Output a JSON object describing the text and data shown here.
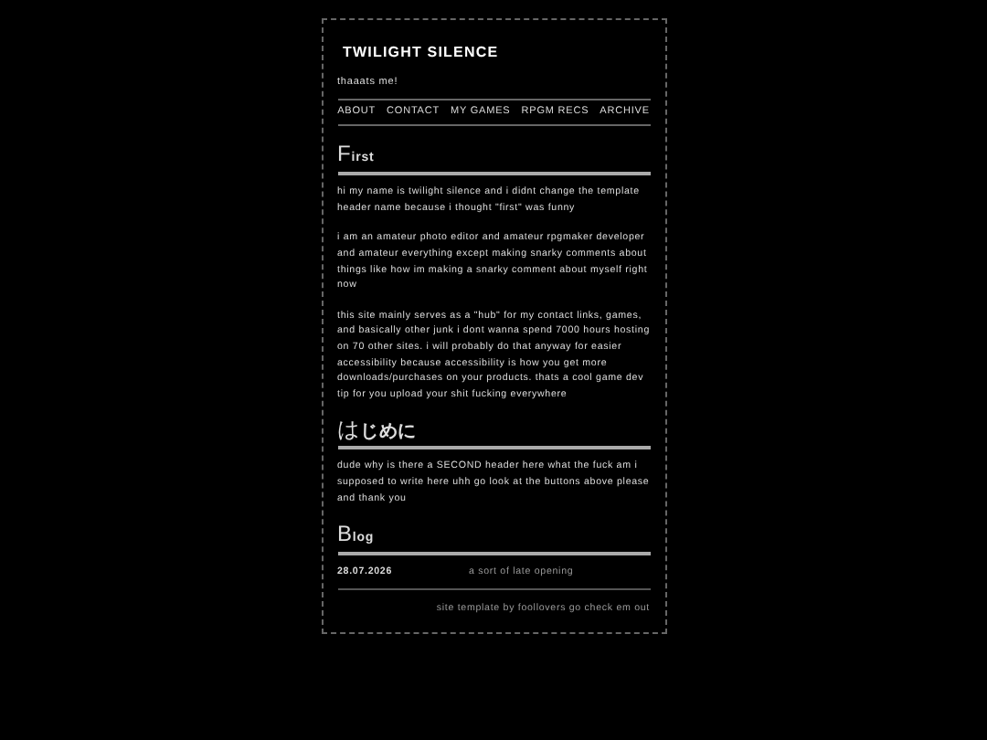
{
  "site": {
    "title": "TWILIGHT SILENCE",
    "tagline": "thaaats me!"
  },
  "nav": [
    {
      "label": "ABOUT"
    },
    {
      "label": "CONTACT"
    },
    {
      "label": "MY GAMES"
    },
    {
      "label": "RPGM RECS"
    },
    {
      "label": "ARCHIVE"
    }
  ],
  "sections": [
    {
      "heading": "First",
      "paragraphs": [
        "hi my name is twilight silence and i didnt change the template header name because i thought \"first\" was funny",
        "i am an amateur photo editor and amateur rpgmaker developer and amateur everything except making snarky comments about things like how im making a snarky comment about myself right now",
        "this site mainly serves as a \"hub\" for my contact links, games, and basically other junk i dont wanna spend 7000 hours hosting on 70 other sites. i will probably do that anyway for easier accessibility because accessibility is how you get more downloads/purchases on your products. thats a cool game dev tip for you upload your shit fucking everywhere"
      ]
    },
    {
      "heading": "はじめに",
      "paragraphs": [
        "dude why is there a SECOND header here what the fuck am i supposed to write here uhh go look at the buttons above please and thank you"
      ]
    }
  ],
  "blog": {
    "heading": "Blog",
    "posts": [
      {
        "date": "28.07.2026",
        "title": "a sort of late opening"
      }
    ]
  },
  "footer": "site template by foollovers go check em out"
}
